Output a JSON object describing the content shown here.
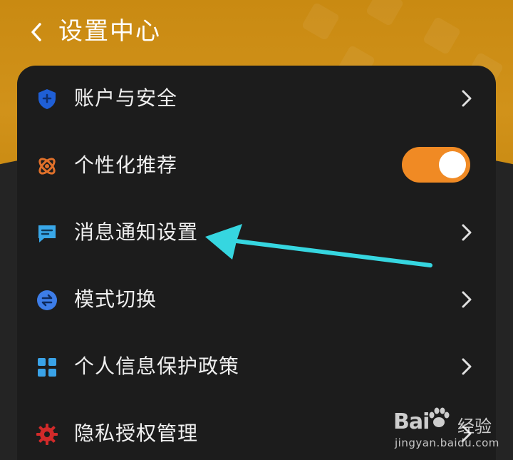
{
  "header": {
    "title": "设置中心",
    "back_icon": "chevron-left-icon"
  },
  "settings": {
    "items": [
      {
        "label": "账户与安全",
        "icon": "shield-plus-icon",
        "icon_color": "#1f5fd6",
        "control": "chevron"
      },
      {
        "label": "个性化推荐",
        "icon": "atom-icon",
        "icon_color": "#e0702a",
        "control": "toggle",
        "toggle_on": true
      },
      {
        "label": "消息通知设置",
        "icon": "message-icon",
        "icon_color": "#39a7e8",
        "control": "chevron"
      },
      {
        "label": "模式切换",
        "icon": "swap-icon",
        "icon_color": "#3d7de8",
        "control": "chevron"
      },
      {
        "label": "个人信息保护政策",
        "icon": "grid-icon",
        "icon_color": "#3aa3e8",
        "control": "chevron"
      },
      {
        "label": "隐私授权管理",
        "icon": "gear-icon",
        "icon_color": "#d12a2a",
        "control": "chevron"
      }
    ]
  },
  "annotation": {
    "arrow_color": "#36d6e0"
  },
  "watermark": {
    "brand_left": "Bai",
    "brand_right": "经验",
    "url": "jingyan.baidu.com"
  },
  "colors": {
    "header_orange": "#c98a12",
    "card_bg": "#1c1c1c",
    "page_bg": "#242424",
    "toggle_on": "#f08a24"
  }
}
